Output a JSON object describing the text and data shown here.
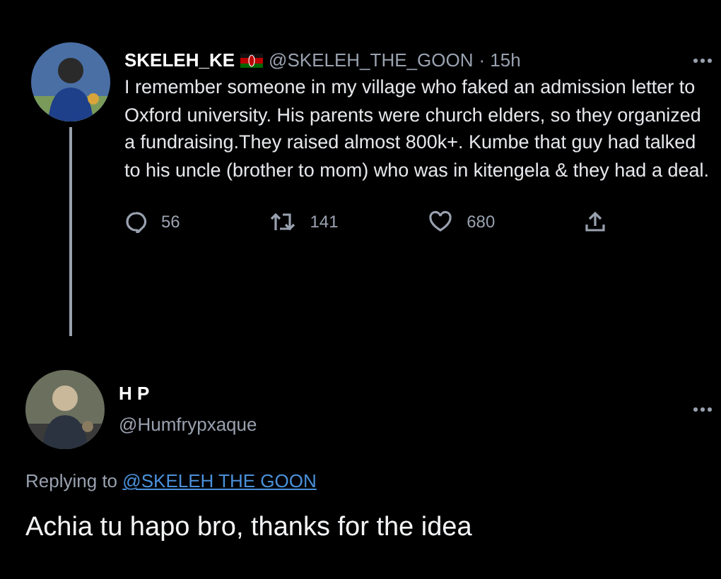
{
  "tweet": {
    "name": "SKELEH_KE",
    "handle": "@SKELEH_THE_GOON",
    "time": "· 15h",
    "text": "I remember someone in my village who faked an admission letter to Oxford university. His parents were church elders, so they organized a fundraising.They raised almost 800k+. Kumbe that guy had talked to his uncle (brother to mom)  who was in kitengela & they had a deal.",
    "actions": [
      {
        "kind": "reply",
        "count": "56"
      },
      {
        "kind": "retweet",
        "count": "141"
      },
      {
        "kind": "like",
        "count": "680"
      },
      {
        "kind": "share"
      }
    ]
  },
  "reply": {
    "name": "H P",
    "handle": "@Humfrypxaque",
    "replying_label": "Replying to",
    "replying_to": "@SKELEH THE GOON",
    "text": "Achia tu hapo bro, thanks for the idea"
  }
}
